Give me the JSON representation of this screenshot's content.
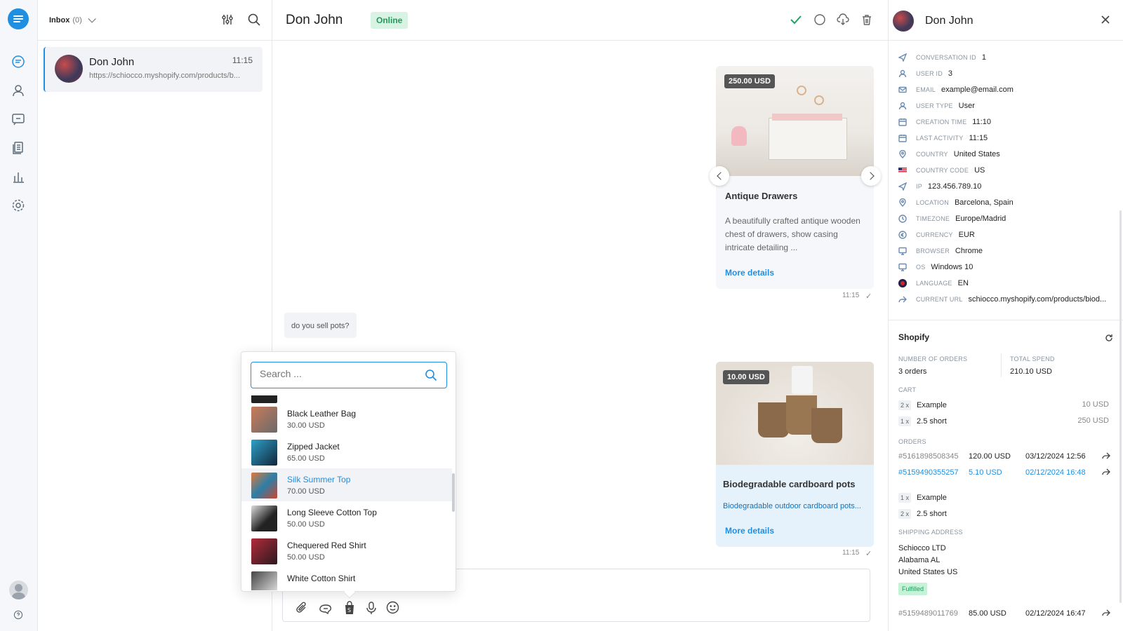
{
  "inbox": {
    "label": "Inbox",
    "count": "(0)"
  },
  "conversation": {
    "name": "Don John",
    "time": "11:15",
    "preview": "https://schiocco.myshopify.com/products/b..."
  },
  "chat": {
    "title": "Don John",
    "status": "Online",
    "card1": {
      "price": "250.00 USD",
      "title": "Antique Drawers",
      "desc": "A beautifully crafted antique wooden chest of drawers, show casing intricate detailing ...",
      "link": "More details",
      "time": "11:15"
    },
    "user_message": "do you sell pots?",
    "card2": {
      "price": "10.00 USD",
      "title": "Biodegradable cardboard pots",
      "desc": "Biodegradable outdoor cardboard pots...",
      "link": "More details",
      "time": "11:15"
    }
  },
  "popup": {
    "search_placeholder": "Search ...",
    "items": [
      {
        "name": "Black Leather Bag",
        "price": "30.00 USD"
      },
      {
        "name": "Zipped Jacket",
        "price": "65.00 USD"
      },
      {
        "name": "Silk Summer Top",
        "price": "70.00 USD"
      },
      {
        "name": "Long Sleeve Cotton Top",
        "price": "50.00 USD"
      },
      {
        "name": "Chequered Red Shirt",
        "price": "50.00 USD"
      },
      {
        "name": "White Cotton Shirt",
        "price": ""
      }
    ]
  },
  "profile": {
    "name": "Don John",
    "fields": [
      {
        "key": "Conversation ID",
        "value": "1",
        "icon": "send-icon"
      },
      {
        "key": "User ID",
        "value": "3",
        "icon": "user-icon"
      },
      {
        "key": "Email",
        "value": "example@email.com",
        "icon": "mail-icon"
      },
      {
        "key": "User type",
        "value": "User",
        "icon": "user-icon"
      },
      {
        "key": "Creation time",
        "value": "11:10",
        "icon": "calendar-icon"
      },
      {
        "key": "Last activity",
        "value": "11:15",
        "icon": "calendar-icon"
      },
      {
        "key": "Country",
        "value": "United States",
        "icon": "pin-icon"
      },
      {
        "key": "Country code",
        "value": "US",
        "icon": "us-flag-icon"
      },
      {
        "key": "IP",
        "value": "123.456.789.10",
        "icon": "send-icon"
      },
      {
        "key": "Location",
        "value": "Barcelona, Spain",
        "icon": "pin-icon"
      },
      {
        "key": "Timezone",
        "value": "Europe/Madrid",
        "icon": "clock-icon"
      },
      {
        "key": "Currency",
        "value": "EUR",
        "icon": "currency-icon"
      },
      {
        "key": "Browser",
        "value": "Chrome",
        "icon": "monitor-icon"
      },
      {
        "key": "OS",
        "value": "Windows 10",
        "icon": "monitor-icon"
      },
      {
        "key": "Language",
        "value": "EN",
        "icon": "uk-flag-icon"
      },
      {
        "key": "Current URL",
        "value": "schiocco.myshopify.com/products/biod...",
        "icon": "share-icon"
      }
    ]
  },
  "shopify": {
    "title": "Shopify",
    "orders_label": "Number of orders",
    "orders_value": "3 orders",
    "spend_label": "Total spend",
    "spend_value": "210.10 USD",
    "cart_label": "Cart",
    "cart": [
      {
        "qty": "2 x",
        "name": "Example",
        "price": "10 USD"
      },
      {
        "qty": "1 x",
        "name": "2.5 short",
        "price": "250 USD"
      }
    ],
    "orders_section_label": "Orders",
    "orders": [
      {
        "id": "#5161898508345",
        "amount": "120.00 USD",
        "date": "03/12/2024 12:56"
      },
      {
        "id": "#5159490355257",
        "amount": "5.10 USD",
        "date": "02/12/2024 16:48"
      }
    ],
    "order_items": [
      {
        "qty": "1 x",
        "name": "Example"
      },
      {
        "qty": "2 x",
        "name": "2.5 short"
      }
    ],
    "shipping_label": "Shipping address",
    "shipping": [
      "Schiocco LTD",
      "Alabama AL",
      "United States US"
    ],
    "fulfilled": "Fulfilled",
    "last_order": {
      "id": "#5159489011769",
      "amount": "85.00 USD",
      "date": "02/12/2024 16:47"
    }
  },
  "colors": {
    "accent": "#1e8fe1",
    "online_bg": "#d8f3e3",
    "online_text": "#1f9a5a",
    "check": "#1fa463"
  }
}
